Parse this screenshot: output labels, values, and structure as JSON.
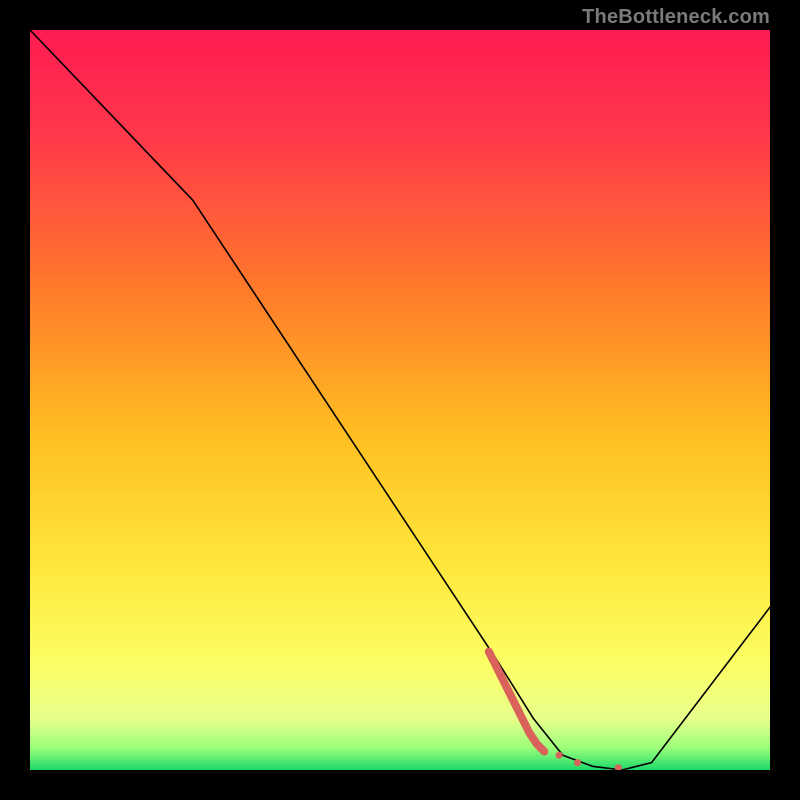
{
  "watermark": "TheBottleneck.com",
  "chart_data": {
    "type": "line",
    "title": "",
    "xlabel": "",
    "ylabel": "",
    "xlim": [
      0,
      100
    ],
    "ylim": [
      0,
      100
    ],
    "series": [
      {
        "name": "bottleneck-curve",
        "x": [
          0,
          22,
          63,
          68,
          72,
          76,
          80,
          84,
          100
        ],
        "y": [
          100,
          77,
          15,
          7,
          2,
          0.5,
          0,
          1,
          22
        ],
        "color": "#000000",
        "width": 1.6
      },
      {
        "name": "sweet-spot-segment",
        "x": [
          62,
          64,
          66,
          67.5,
          68.5,
          69.5
        ],
        "y": [
          16,
          12,
          8,
          5,
          3.5,
          2.5
        ],
        "color": "#d9625a",
        "width": 8
      }
    ],
    "points": [
      {
        "name": "sweet-spot-p1",
        "x": 71.5,
        "y": 2.0,
        "r": 3.5,
        "color": "#d9625a"
      },
      {
        "name": "sweet-spot-p2",
        "x": 74.0,
        "y": 1.0,
        "r": 3.5,
        "color": "#d9625a"
      },
      {
        "name": "sweet-spot-p3",
        "x": 79.5,
        "y": 0.3,
        "r": 3.5,
        "color": "#d9625a"
      }
    ],
    "gradient_stops": [
      {
        "offset": 0,
        "color": "#ff1a52"
      },
      {
        "offset": 15,
        "color": "#ff3a4a"
      },
      {
        "offset": 35,
        "color": "#ff7a2a"
      },
      {
        "offset": 55,
        "color": "#ffc022"
      },
      {
        "offset": 72,
        "color": "#ffe63a"
      },
      {
        "offset": 86,
        "color": "#fbff66"
      },
      {
        "offset": 93,
        "color": "#e8ff8c"
      },
      {
        "offset": 97,
        "color": "#9cff7a"
      },
      {
        "offset": 100,
        "color": "#1bd96b"
      }
    ]
  }
}
